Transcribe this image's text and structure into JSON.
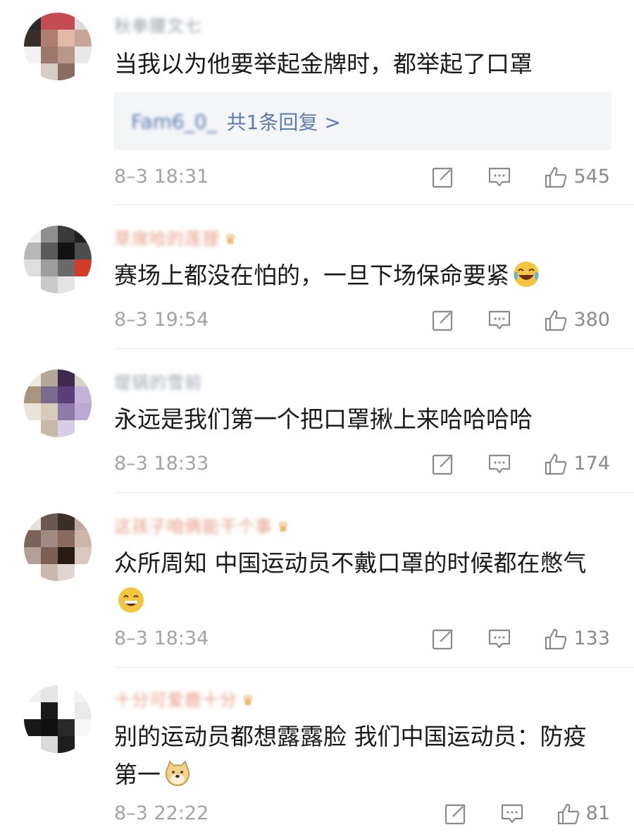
{
  "comments": [
    {
      "username": "秋拳腰文七",
      "has_crown": false,
      "avatar_colors": [
        "#2a2a2a",
        "#c24b54",
        "#c24b54",
        "#dcdcdc",
        "#3a2e2a",
        "#b07e70",
        "#e2b8a6",
        "#c9a49a",
        "#f2f2f2",
        "#9d7769",
        "#b9978a",
        "#e8e8e8",
        "#ffffff",
        "#d8ccc6",
        "#8b6c62",
        "#ffffff"
      ],
      "text": "当我以为他要举起金牌时，都举起了口罩",
      "reply": {
        "user": "Fam6_0_",
        "label": "共1条回复 >"
      },
      "time": "8–3 18:31",
      "likes": "545"
    },
    {
      "username": "草席哈的莲狸",
      "has_crown": true,
      "avatar_colors": [
        "#efefef",
        "#8f8f8f",
        "#3a3a3a",
        "#1e1e1e",
        "#b8b8b8",
        "#5a5a5a",
        "#121212",
        "#4e4e4e",
        "#dedede",
        "#9e9e9e",
        "#6a6a6a",
        "#d23a2a",
        "#ffffff",
        "#c9c9c9",
        "#e4e4e4",
        "#ffffff"
      ],
      "text": "赛场上都没在怕的，一旦下场保命要紧",
      "reply": null,
      "time": "8–3 19:54",
      "likes": "380"
    },
    {
      "username": "堤锅的雪前",
      "has_crown": false,
      "avatar_colors": [
        "#efe9e2",
        "#b3a898",
        "#3d2a4c",
        "#d8cfc6",
        "#a7967e",
        "#7a6a8c",
        "#5b3f7a",
        "#c2b3d8",
        "#e9e3dc",
        "#d6cbbd",
        "#8d7aa8",
        "#b9a9d3",
        "#ffffff",
        "#c6b9a8",
        "#d7cde6",
        "#ffffff"
      ],
      "text": "永远是我们第一个把口罩揪上来哈哈哈哈",
      "reply": null,
      "time": "8–3 18:33",
      "likes": "174"
    },
    {
      "username": "这孩子咱俩能干个事",
      "has_crown": true,
      "avatar_colors": [
        "#e5e0dc",
        "#6c5852",
        "#3c2e2a",
        "#bcaaa2",
        "#7b625a",
        "#a08a82",
        "#8a6a5e",
        "#cdb7ab",
        "#b39f98",
        "#7c5e55",
        "#2a1a16",
        "#d8c8c1",
        "#ffffff",
        "#c9b7b0",
        "#e0d6d1",
        "#ffffff"
      ],
      "text": "众所周知  中国运动员不戴口罩的时候都在憋气",
      "reply": null,
      "time": "8–3 18:34",
      "likes": "133"
    },
    {
      "username": "十分可爱鹿十分",
      "has_crown": true,
      "avatar_colors": [
        "#f0f0f0",
        "#e6e6e6",
        "#ffffff",
        "#f2f2f2",
        "#ffffff",
        "#1a1a1a",
        "#ffffff",
        "#eaeaea",
        "#1a1a1a",
        "#101010",
        "#2a2a2a",
        "#f7f7f7",
        "#ffffff",
        "#d9d9d9",
        "#1e1e1e",
        "#ffffff"
      ],
      "text": "别的运动员都想露露脸 我们中国运动员：防疫第一",
      "reply": null,
      "time": "8–3 22:22",
      "likes": "81"
    }
  ],
  "icons": {
    "share": "share-icon",
    "comment": "comment-icon",
    "like": "thumbs-up-icon",
    "crown": "crown-badge-icon"
  }
}
